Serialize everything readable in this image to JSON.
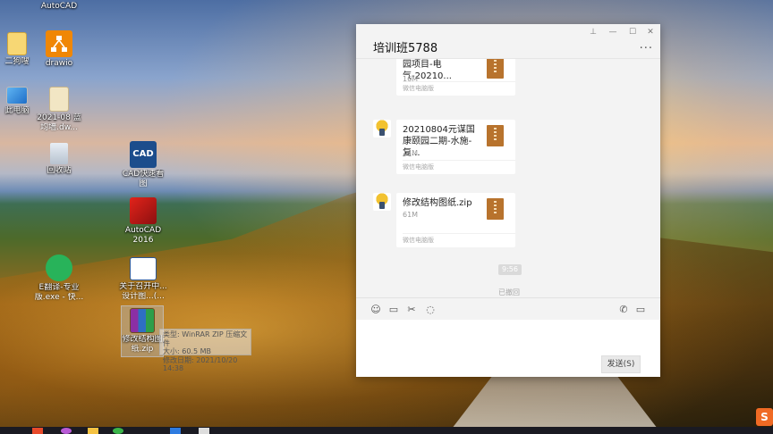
{
  "desktop": {
    "icons": [
      {
        "id": "autocad-top",
        "label1": "AutoCAD",
        "label2": ""
      },
      {
        "id": "folder",
        "label1": "二狗嗖",
        "label2": ""
      },
      {
        "id": "drawio",
        "label1": "drawio",
        "label2": ""
      },
      {
        "id": "this-pc",
        "label1": "此电脑",
        "label2": ""
      },
      {
        "id": "dwg-file",
        "label1": "2021-08 蓝",
        "label2": "均墙.dw..."
      },
      {
        "id": "recycle-bin",
        "label1": "回收站",
        "label2": ""
      },
      {
        "id": "cad-tool",
        "label1": "CAD快速看",
        "label2": "图"
      },
      {
        "id": "autocad2016",
        "label1": "AutoCAD",
        "label2": "2016"
      },
      {
        "id": "efanyi",
        "label1": "E翻译-专业",
        "label2": "版.exe - 快..."
      },
      {
        "id": "notice-doc",
        "label1": "关于召开中...",
        "label2": "设计图...(..."
      },
      {
        "id": "zip-file",
        "label1": "修改结构图",
        "label2": "纸.zip"
      }
    ],
    "tooltip": {
      "line1": "类型: WinRAR ZIP 压缩文件",
      "line2": "大小: 60.5 MB",
      "line3": "修改日期: 2021/10/20 14:38"
    },
    "ime_label": "S"
  },
  "chat": {
    "title": "培训班5788",
    "window_controls": [
      "pin",
      "minimize",
      "maximize",
      "close"
    ],
    "messages": [
      {
        "name": "园项目-电气-20210...",
        "size": "16M",
        "source": "微信电脑版"
      },
      {
        "name": "20210804元谋国康颐园二期-水施-复...",
        "size": "14M",
        "source": "微信电脑版"
      },
      {
        "name": "修改结构图纸.zip",
        "size": "61M",
        "source": "微信电脑版"
      }
    ],
    "timestamp": "9:56",
    "recall_note": "已撤回",
    "send_label": "发送(S)"
  }
}
